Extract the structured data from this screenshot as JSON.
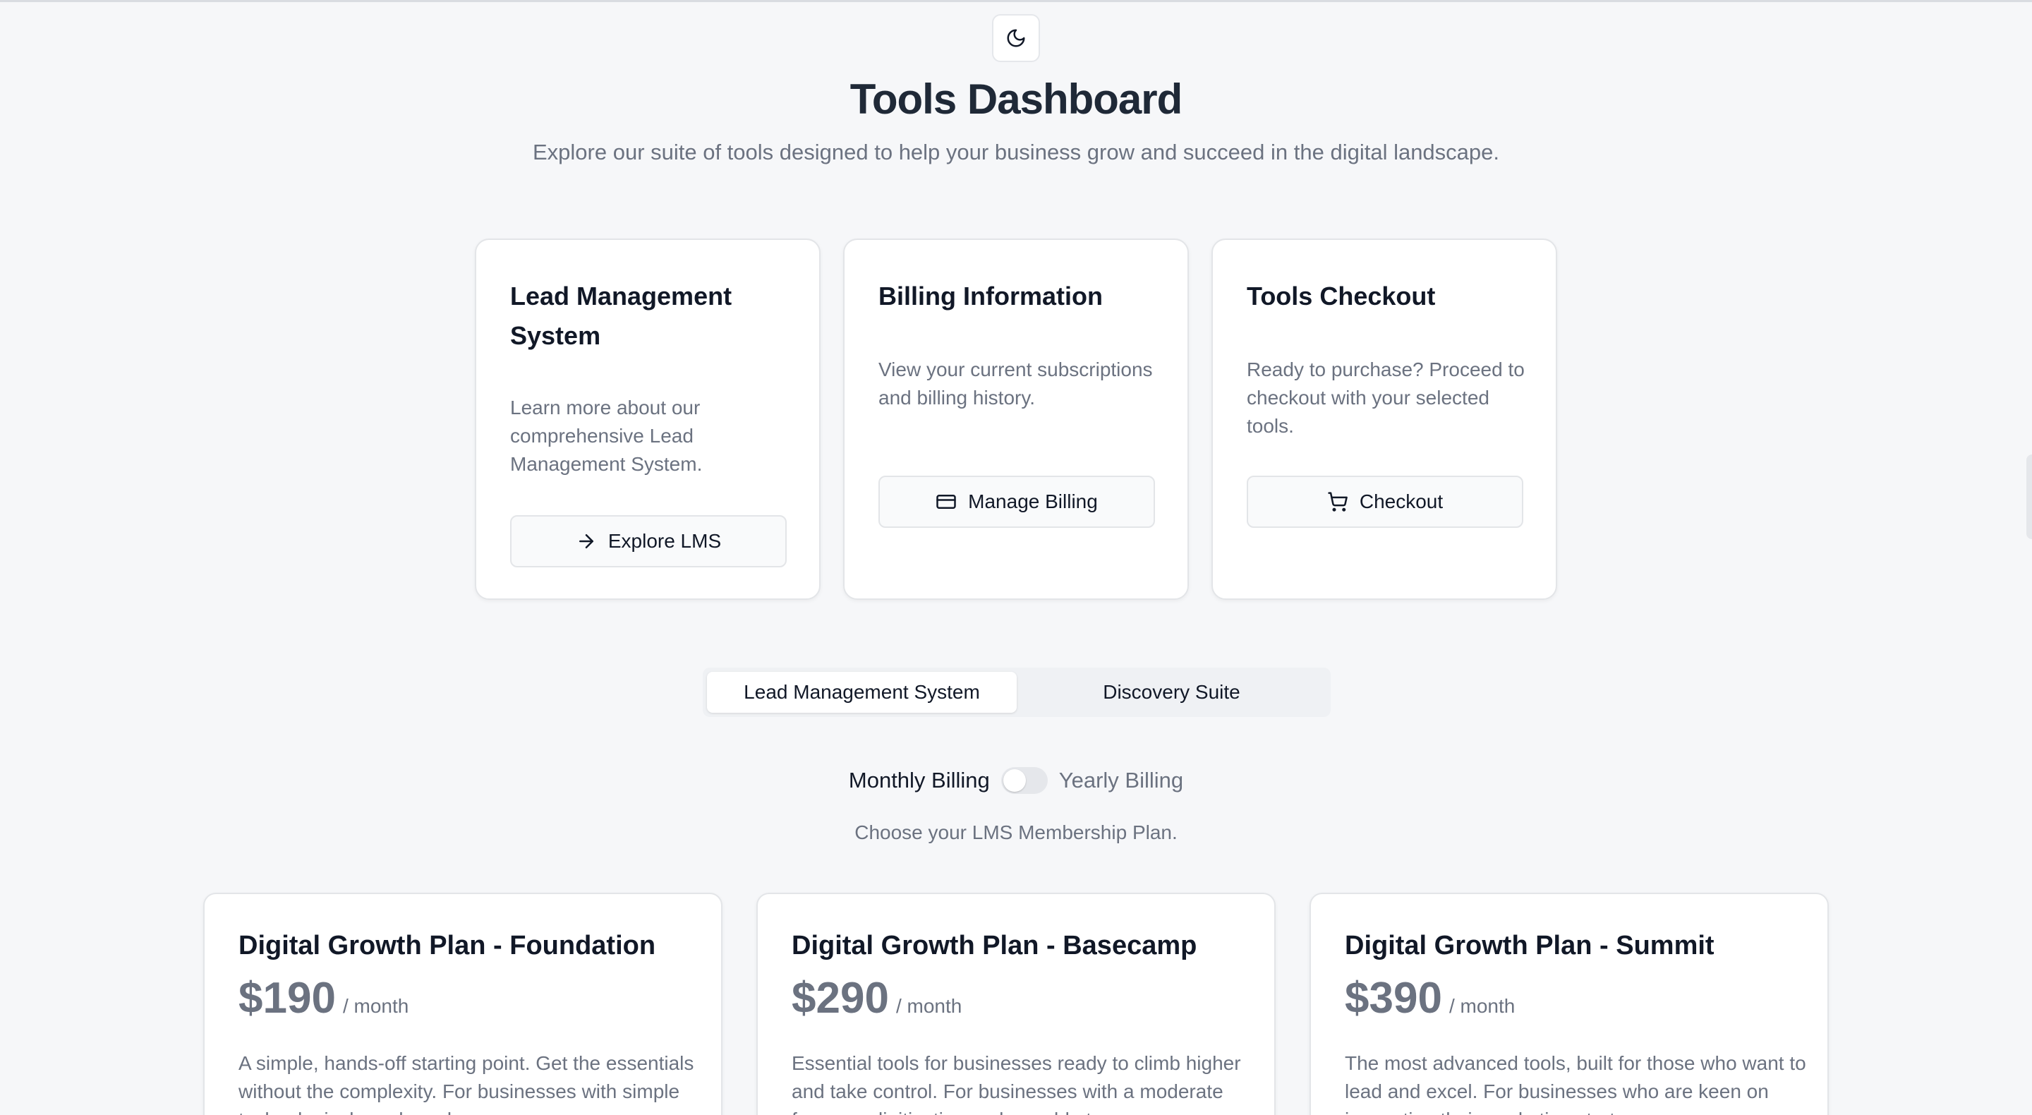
{
  "header": {
    "theme_toggle_icon": "moon-icon",
    "title": "Tools Dashboard",
    "subtitle": "Explore our suite of tools designed to help your business grow and succeed in the digital landscape."
  },
  "tool_cards": [
    {
      "title": "Lead Management System",
      "description": "Learn more about our comprehensive Lead Management System.",
      "button_label": "Explore LMS",
      "button_icon": "arrow-right-icon"
    },
    {
      "title": "Billing Information",
      "description": "View your current subscriptions and billing history.",
      "button_label": "Manage Billing",
      "button_icon": "credit-card-icon"
    },
    {
      "title": "Tools Checkout",
      "description": "Ready to purchase? Proceed to checkout with your selected tools.",
      "button_label": "Checkout",
      "button_icon": "shopping-cart-icon"
    }
  ],
  "tabs": [
    {
      "label": "Lead Management System",
      "active": true
    },
    {
      "label": "Discovery Suite",
      "active": false
    }
  ],
  "billing_toggle": {
    "monthly_label": "Monthly Billing",
    "yearly_label": "Yearly Billing",
    "yearly_selected": false
  },
  "plans_intro": "Choose your LMS Membership Plan.",
  "plans": [
    {
      "name": "Digital Growth Plan - Foundation",
      "price": "$190",
      "period": "/ month",
      "description": "A simple, hands-off starting point. Get the essentials without the complexity. For businesses with simple technological needs and"
    },
    {
      "name": "Digital Growth Plan - Basecamp",
      "price": "$290",
      "period": "/ month",
      "description": "Essential tools for businesses ready to climb higher and take control. For businesses with a moderate focus on digitization and are able to"
    },
    {
      "name": "Digital Growth Plan - Summit",
      "price": "$390",
      "period": "/ month",
      "description": "The most advanced tools, built for those who want to lead and excel. For businesses who are keen on innovating their marketing strategy"
    }
  ],
  "colors": {
    "background": "#f6f7f9",
    "card": "#ffffff",
    "text_primary": "#111827",
    "text_muted": "#6b7280",
    "border": "#e3e5e8"
  }
}
